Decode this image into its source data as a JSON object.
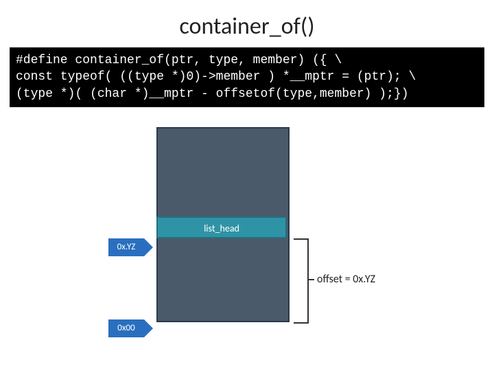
{
  "title": "container_of()",
  "code": {
    "line1": "#define container_of(ptr, type, member) ({ \\",
    "line2": "const typeof( ((type *)0)->member ) *__mptr = (ptr); \\",
    "line3": "(type *)( (char *)__mptr - offsetof(type,member) );})"
  },
  "diagram": {
    "list_head_label": "list_head",
    "ptr_member": "0x.YZ",
    "ptr_base": "0x00",
    "offset_label": "offset = 0x.YZ"
  }
}
